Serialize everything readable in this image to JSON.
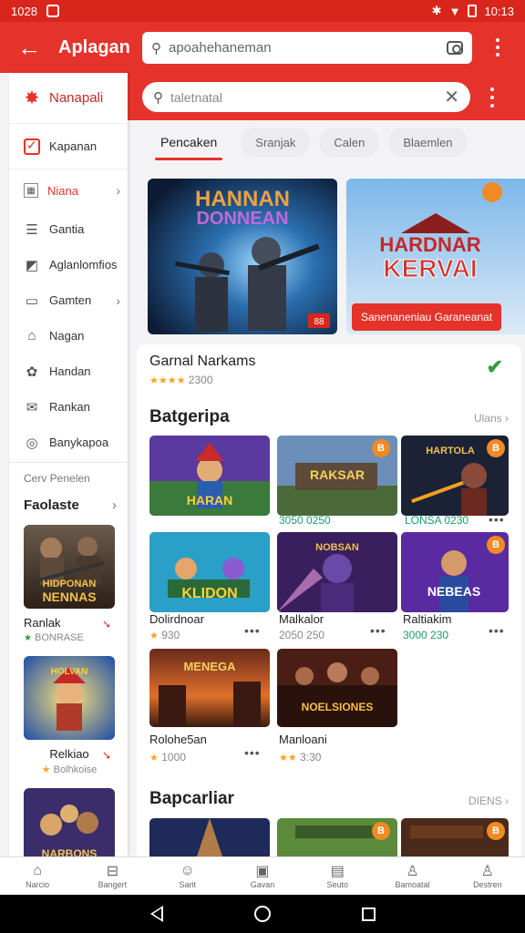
{
  "status_bar": {
    "time": "1028",
    "time_right": "10:13"
  },
  "app_bar": {
    "title": "Aplagan",
    "search_value": "apoahehaneman"
  },
  "search": {
    "value": "taletnatal"
  },
  "sidebar": {
    "header": "Nanapali",
    "items": [
      {
        "label": "Kapanan",
        "icon": "checklist-icon"
      },
      {
        "label": "Niana",
        "icon": "grid-icon",
        "chevron": true
      },
      {
        "label": "Gantia",
        "icon": "list-icon"
      },
      {
        "label": "Aglanlomfios",
        "icon": "folder-icon"
      },
      {
        "label": "Gamten",
        "icon": "card-icon",
        "chevron": true
      },
      {
        "label": "Nagan",
        "icon": "home-icon"
      },
      {
        "label": "Handan",
        "icon": "settings-icon"
      },
      {
        "label": "Rankan",
        "icon": "mail-icon"
      },
      {
        "label": "Banykapoa",
        "icon": "globe-icon"
      }
    ],
    "sub_label": "Cerv Penelen",
    "section_title": "Faolaste",
    "cards": [
      {
        "name": "Ranlak",
        "meta": "BONRASE"
      },
      {
        "name": "Relkiao",
        "meta": "Bolhkoise"
      }
    ],
    "card3_title": "NARBONS"
  },
  "tabs": [
    "Pencaken",
    "Sranjak",
    "Calen",
    "Blaemlen"
  ],
  "banners": {
    "b1_title1": "HANNAN",
    "b1_title2": "DONNEAN",
    "b1_badge": "88",
    "b2_title1": "HARDNAR",
    "b2_title2": "KERVAI",
    "b2_button": "Sanenaneniau Garaneanat"
  },
  "featured": {
    "name": "Garnal Narkams",
    "rating": "2300"
  },
  "section1": {
    "title": "Batgeripa",
    "more": "Ulans",
    "games": [
      {
        "name": "",
        "meta": "",
        "title_art": "HARAN"
      },
      {
        "name": "",
        "meta": "3050 0250",
        "title_art": "RAKSAR"
      },
      {
        "name": "",
        "meta": "LONSA 0230",
        "title_art": "HARTOLA"
      },
      {
        "name": "Dolirdnoar",
        "meta": "930",
        "title_art": "KLIDON"
      },
      {
        "name": "Malkalor",
        "meta": "2050 250",
        "title_art": "NOBSAN"
      },
      {
        "name": "Raltiakim",
        "meta": "3000 230",
        "title_art": "NEBEAS"
      },
      {
        "name": "Rolohe5an",
        "meta": "1000",
        "title_art": "MENEGA"
      },
      {
        "name": "Manloani",
        "meta": "3:30",
        "title_art": "NOELSIONES"
      }
    ]
  },
  "section2": {
    "title": "Bapcarliar",
    "more": "DIENS"
  },
  "bottom_nav": [
    "Narcio",
    "Bangert",
    "Sarit",
    "Gavan",
    "Seuto",
    "Bamoatal",
    "Destren"
  ],
  "colors": {
    "primary": "#e5322a",
    "green": "#2e9e3c",
    "star": "#f5a623"
  }
}
